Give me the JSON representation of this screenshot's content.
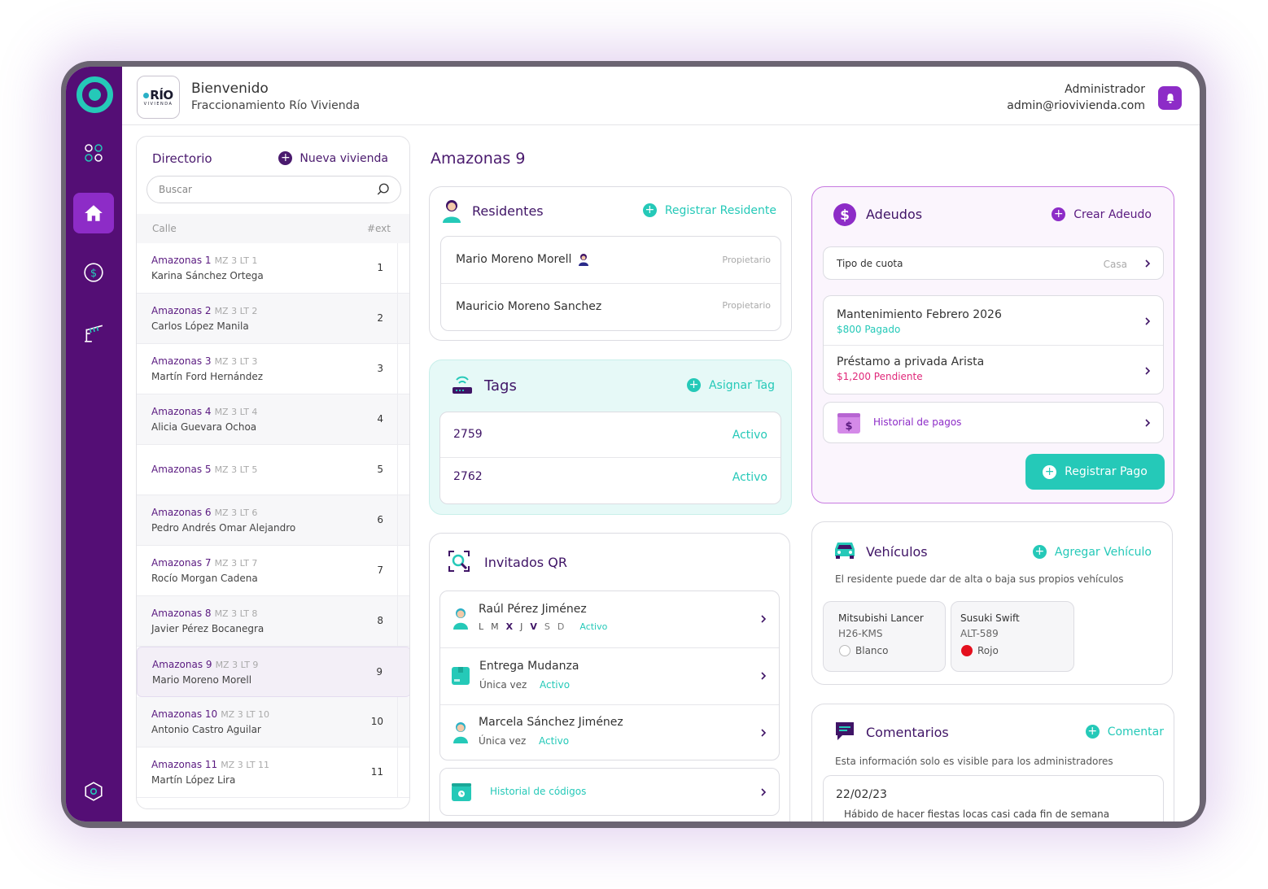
{
  "header": {
    "logo_text": "RÍO",
    "logo_sub": "VIVIENDA",
    "welcome": "Bienvenido",
    "community": "Fraccionamiento Río Vivienda",
    "role": "Administrador",
    "email": "admin@riovivienda.com"
  },
  "directory": {
    "title": "Directorio",
    "new_label": "Nueva vivienda",
    "search_placeholder": "Buscar",
    "col_street": "Calle",
    "col_ext": "#ext",
    "rows": [
      {
        "street": "Amazonas 1",
        "mz": "MZ 3 LT 1",
        "owner": "Karina Sánchez Ortega",
        "num": "1"
      },
      {
        "street": "Amazonas 2",
        "mz": "MZ 3 LT 2",
        "owner": "Carlos López Manila",
        "num": "2"
      },
      {
        "street": "Amazonas 3",
        "mz": "MZ 3 LT 3",
        "owner": "Martín Ford Hernández",
        "num": "3"
      },
      {
        "street": "Amazonas 4",
        "mz": "MZ 3 LT 4",
        "owner": "Alicia Guevara Ochoa",
        "num": "4"
      },
      {
        "street": "Amazonas 5",
        "mz": "MZ 3 LT 5",
        "owner": "",
        "num": "5"
      },
      {
        "street": "Amazonas 6",
        "mz": "MZ 3 LT 6",
        "owner": "Pedro Andrés Omar Alejandro",
        "num": "6"
      },
      {
        "street": "Amazonas 7",
        "mz": "MZ 3 LT 7",
        "owner": "Rocío Morgan Cadena",
        "num": "7"
      },
      {
        "street": "Amazonas 8",
        "mz": "MZ 3 LT 8",
        "owner": "Javier Pérez Bocanegra",
        "num": "8"
      },
      {
        "street": "Amazonas 9",
        "mz": "MZ 3 LT 9",
        "owner": "Mario Moreno Morell",
        "num": "9"
      },
      {
        "street": "Amazonas 10",
        "mz": "MZ 3 LT 10",
        "owner": "Antonio Castro Aguilar",
        "num": "10"
      },
      {
        "street": "Amazonas 11",
        "mz": "MZ 3 LT 11",
        "owner": "Martín López Lira",
        "num": "11"
      }
    ]
  },
  "page_title": "Amazonas 9",
  "residents": {
    "title": "Residentes",
    "action": "Registrar Residente",
    "items": [
      {
        "name": "Mario Moreno Morell",
        "role": "Propietario"
      },
      {
        "name": "Mauricio Moreno Sanchez",
        "role": "Propietario"
      }
    ]
  },
  "tags": {
    "title": "Tags",
    "action": "Asignar Tag",
    "items": [
      {
        "code": "2759",
        "status": "Activo"
      },
      {
        "code": "2762",
        "status": "Activo"
      }
    ]
  },
  "guests": {
    "title": "Invitados QR",
    "items": [
      {
        "name": "Raúl Pérez Jiménez",
        "days": [
          "L",
          "M",
          "X",
          "J",
          "V",
          "S",
          "D"
        ],
        "status": "Activo"
      },
      {
        "name": "Entrega Mudanza",
        "freq": "Única vez",
        "status": "Activo"
      },
      {
        "name": "Marcela Sánchez Jiménez",
        "freq": "Única vez",
        "status": "Activo"
      }
    ],
    "history": "Historial de códigos"
  },
  "debts": {
    "title": "Adeudos",
    "action": "Crear Adeudo",
    "quota_label": "Tipo de cuota",
    "quota_value": "Casa",
    "items": [
      {
        "title": "Mantenimiento Febrero 2026",
        "amount": "$800 Pagado",
        "color": "#25c9b8"
      },
      {
        "title": "Préstamo a privada Arista",
        "amount": "$1,200 Pendiente",
        "color": "#e0287a"
      }
    ],
    "history": "Historial de pagos",
    "pay_button": "Registrar Pago"
  },
  "vehicles": {
    "title": "Vehículos",
    "action": "Agregar Vehículo",
    "note": "El residente puede dar de alta o baja sus propios vehículos",
    "items": [
      {
        "model": "Mitsubishi Lancer",
        "plate": "H26-KMS",
        "color_name": "Blanco",
        "color": "#ffffff"
      },
      {
        "model": "Susuki Swift",
        "plate": "ALT-589",
        "color_name": "Rojo",
        "color": "#e4101e"
      }
    ]
  },
  "comments": {
    "title": "Comentarios",
    "action": "Comentar",
    "note": "Esta información solo es visible para los administradores",
    "items": [
      {
        "date": "22/02/23",
        "text": "Hábido de hacer fiestas locas casi cada fin de semana"
      }
    ]
  },
  "colors": {
    "sidebar": "#540e75",
    "accent_teal": "#25c9b8",
    "accent_purple": "#8d2cc7",
    "text_purple": "#4a1a6e"
  },
  "icons": {
    "sidebar": [
      "ring-logo-icon",
      "apps-grid-icon",
      "home-icon",
      "dollar-icon",
      "gate-barrier-icon",
      "settings-hex-icon"
    ]
  }
}
